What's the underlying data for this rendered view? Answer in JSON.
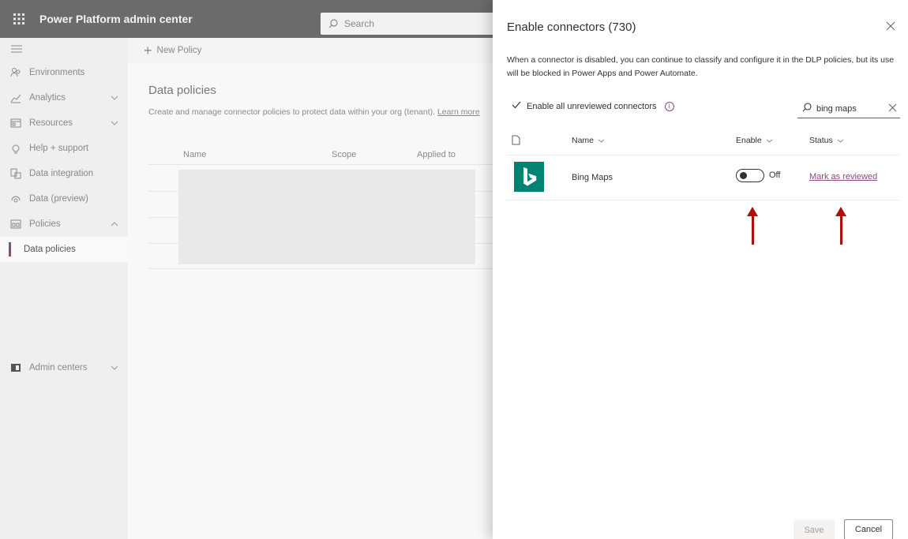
{
  "app": {
    "title": "Power Platform admin center",
    "search_placeholder": "Search"
  },
  "leftnav": {
    "items": [
      {
        "label": "Environments",
        "icon": "environments-icon"
      },
      {
        "label": "Analytics",
        "icon": "analytics-icon",
        "expandable": true
      },
      {
        "label": "Resources",
        "icon": "resources-icon",
        "expandable": true
      },
      {
        "label": "Help + support",
        "icon": "help-icon"
      },
      {
        "label": "Data integration",
        "icon": "data-integration-icon"
      },
      {
        "label": "Data (preview)",
        "icon": "data-preview-icon"
      },
      {
        "label": "Policies",
        "icon": "policies-icon",
        "expanded": true
      },
      {
        "label": "Data policies",
        "selected": true
      },
      {
        "label": "Admin centers",
        "icon": "admin-centers-icon",
        "expandable": true
      }
    ]
  },
  "main": {
    "new_policy_label": "New Policy",
    "title": "Data policies",
    "description": "Create and manage connector policies to protect data within your org (tenant).",
    "learn_more": "Learn more",
    "columns": [
      "Name",
      "Scope",
      "Applied to"
    ]
  },
  "panel": {
    "title": "Enable connectors (730)",
    "description": "When a connector is disabled, you can continue to classify and configure it in the DLP policies, but its use will be blocked in Power Apps and Power Automate.",
    "enable_all_label": "Enable all unreviewed connectors",
    "search_value": "bing maps",
    "columns": {
      "name": "Name",
      "enable": "Enable",
      "status": "Status"
    },
    "rows": [
      {
        "name": "Bing Maps",
        "toggle_label": "Off",
        "enabled": false,
        "status_link": "Mark as reviewed"
      }
    ],
    "save_label": "Save",
    "cancel_label": "Cancel"
  },
  "colors": {
    "topbar": "#6b6b6b",
    "accent": "#8a4a7a",
    "bing_green": "#008373",
    "annotation_arrow": "#b00e0e"
  }
}
